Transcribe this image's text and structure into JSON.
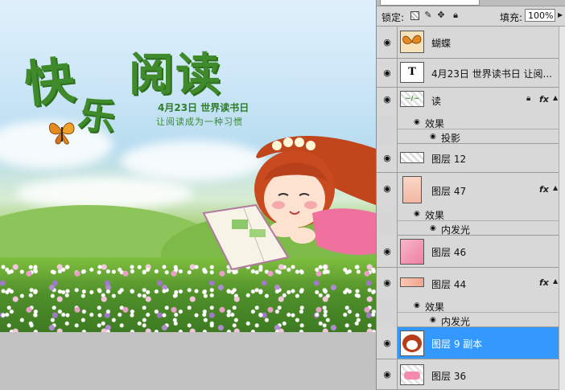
{
  "artwork": {
    "title_char1": "快",
    "title_char2": "乐",
    "title_main": "阅读",
    "event": "4月23日 世界读书日",
    "slogan": "让阅读成为一种习惯"
  },
  "panel": {
    "lock_label": "锁定:",
    "fill_label": "填充:",
    "fill_value": "100%",
    "layers": [
      {
        "name": "蝴蝶",
        "thumb": "butterfly",
        "fx": "",
        "selected": false
      },
      {
        "name": "4月23日 世界读书日 让阅...",
        "thumb": "text",
        "thumb_text": "T",
        "fx": "",
        "selected": false
      },
      {
        "name": "读",
        "thumb": "green-text",
        "fx": "fx",
        "selected": false,
        "effects_label": "效果",
        "effect": "投影"
      },
      {
        "name": "图层 12",
        "thumb": "transparent",
        "fx": "",
        "selected": false
      },
      {
        "name": "图层 47",
        "thumb": "skin",
        "fx": "fx",
        "selected": false,
        "effects_label": "效果",
        "effect": "内发光"
      },
      {
        "name": "图层 46",
        "thumb": "pink",
        "fx": "",
        "selected": false
      },
      {
        "name": "图层 44",
        "thumb": "skin-bar",
        "fx": "fx",
        "selected": false,
        "effects_label": "效果",
        "effect": "内发光"
      },
      {
        "name": "图层 9 副本",
        "thumb": "red-face",
        "fx": "",
        "selected": true
      },
      {
        "name": "图层 36",
        "thumb": "pink-dress",
        "fx": "",
        "selected": false
      }
    ]
  },
  "icons": {
    "eye": "eye-icon",
    "lock_transparent": "lock-transparency-icon",
    "lock_paint": "brush-icon",
    "lock_move": "move-icon",
    "lock_all": "lock-icon"
  }
}
